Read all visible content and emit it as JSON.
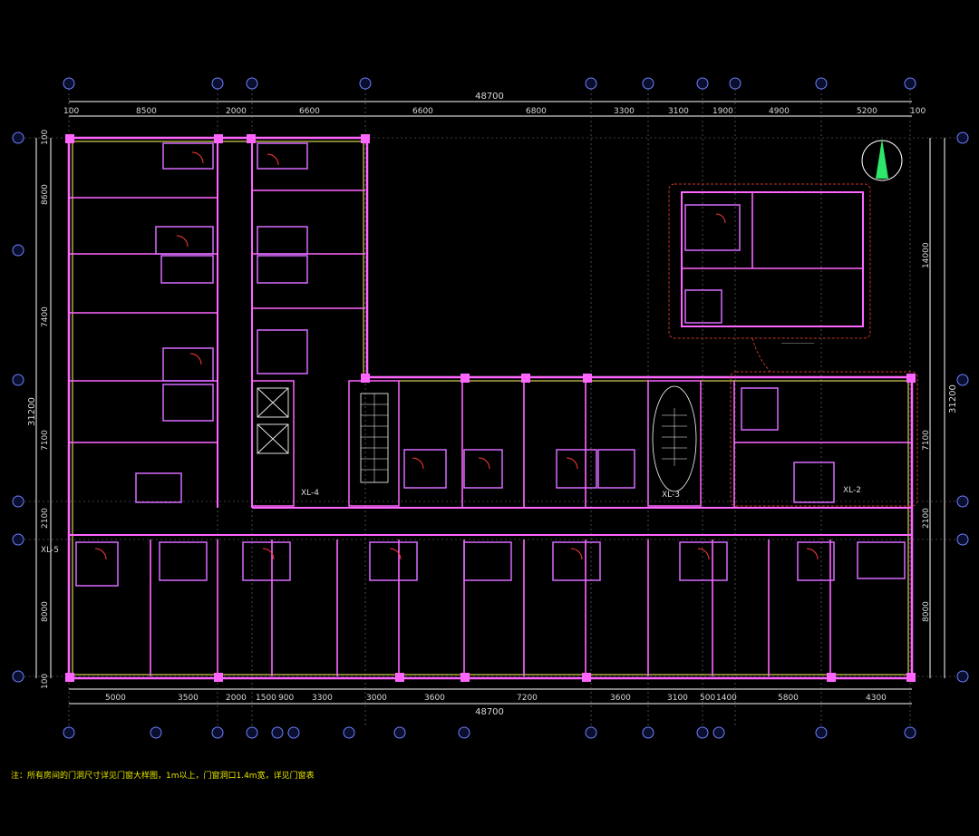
{
  "drawing": {
    "top_dimensions": [
      "100",
      "8500",
      "2000",
      "6600",
      "6600",
      "6800",
      "3300",
      "3100",
      "1900",
      "4900",
      "5200",
      "100"
    ],
    "top_total": "48700",
    "bottom_dimensions": [
      "5000",
      "3500",
      "2000",
      "1500",
      "900",
      "3300",
      "3000",
      "3600",
      "7200",
      "3600",
      "3100",
      "500",
      "1400",
      "5800",
      "4300"
    ],
    "bottom_total": "48700",
    "left_dimensions": [
      "100",
      "8600",
      "7400",
      "7100",
      "2100",
      "8000",
      "100"
    ],
    "left_total": "31200",
    "right_dimensions": [
      "14000",
      "7100",
      "2100",
      "8000"
    ],
    "right_total": "31200",
    "annotations": [
      "XL-4",
      "XL-3",
      "XL-2",
      "XL-5"
    ],
    "note": "注：所有房间的门洞尺寸详见门窗大样图，1m以上，门窗洞口1.4m宽，详见门窗表"
  },
  "colors": {
    "background": "#000000",
    "dimension_line": "#ffffff",
    "wall": "#ff66ff",
    "wall_fill": "#b04ad8",
    "yellow_line": "#ffff66",
    "axis_bubble": "#6f7fff",
    "detail_box": "#c0392b",
    "north_arrow": "#2ee66a"
  }
}
